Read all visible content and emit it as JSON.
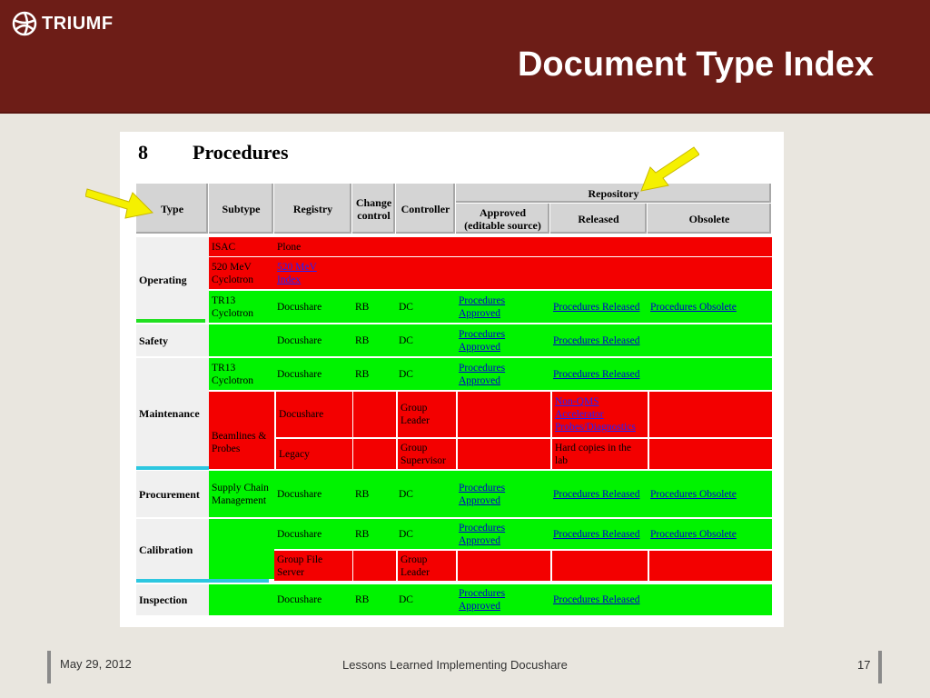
{
  "header": {
    "logo_text": "TRIUMF",
    "title": "Document Type Index"
  },
  "section": {
    "number": "8",
    "title": "Procedures"
  },
  "table": {
    "headers": {
      "type": "Type",
      "subtype": "Subtype",
      "registry": "Registry",
      "change_control": "Change control",
      "controller": "Controller",
      "repository": "Repository",
      "approved": "Approved (editable source)",
      "released": "Released",
      "obsolete": "Obsolete"
    },
    "types": {
      "operating": "Operating",
      "safety": "Safety",
      "maintenance": "Maintenance",
      "procurement": "Procurement",
      "calibration": "Calibration",
      "inspection": "Inspection"
    },
    "cells": {
      "isac": "ISAC",
      "plone": "Plone",
      "cyc520": "520 MeV Cyclotron",
      "cyc520_link": "520 MeV Index",
      "tr13": "TR13 Cyclotron",
      "docushare": "Docushare",
      "rb": "RB",
      "dc": "DC",
      "proc_approved": "Procedures Approved",
      "proc_released": "Procedures Released",
      "proc_obsolete": "Procedures Obsolete",
      "beamlines": "Beamlines & Probes",
      "group_leader": "Group Leader",
      "non_qms": "Non-QMS Accelerator Probes/Diagnostics",
      "legacy": "Legacy",
      "group_supervisor": "Group Supervisor",
      "hard_copies": "Hard copies in the lab",
      "supply_chain": "Supply Chain Management",
      "group_file_server": "Group File Server"
    }
  },
  "footer": {
    "date": "May 29, 2012",
    "center": "Lessons Learned Implementing Docushare",
    "page": "17"
  },
  "colors": {
    "header_bg": "#6d1d17",
    "green": "#00f300",
    "red": "#f30000",
    "arrow": "#f5f000"
  }
}
